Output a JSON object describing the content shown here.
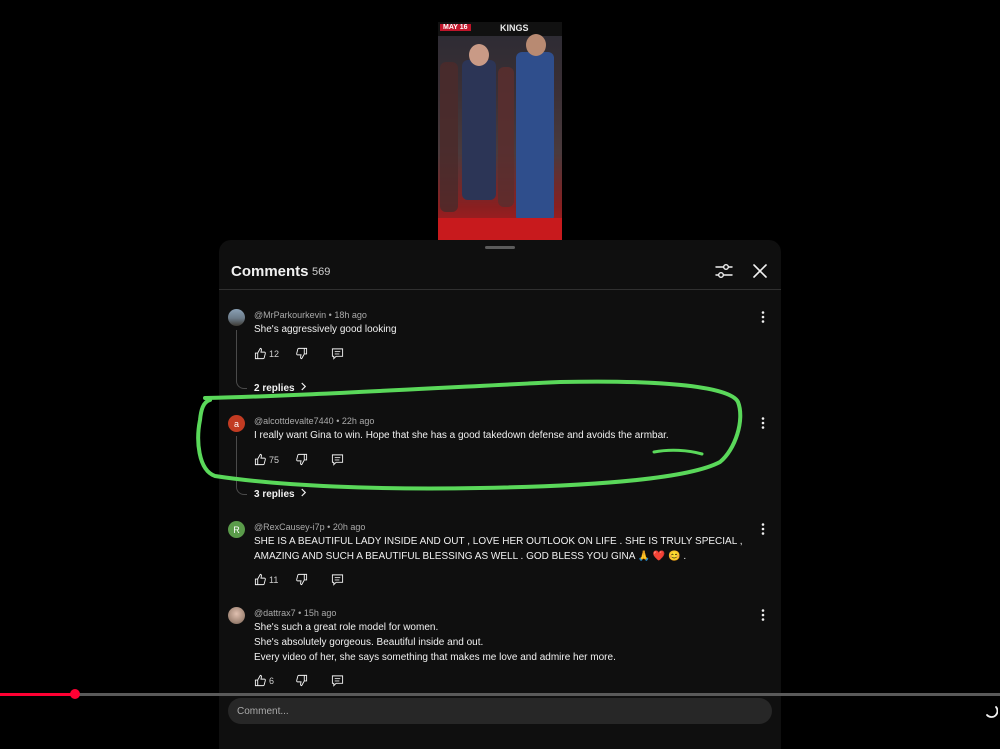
{
  "video": {
    "date_badge": "MAY 16",
    "brand_text": "KINGS"
  },
  "comments_panel": {
    "title": "Comments",
    "count": "569"
  },
  "comments": [
    {
      "avatar_letter": "",
      "avatar_color": "#6b7a88",
      "author": "@MrParkourkevin",
      "time": "18h ago",
      "text": [
        "She's aggressively good looking"
      ],
      "likes": "12",
      "replies_label": "2 replies"
    },
    {
      "avatar_letter": "a",
      "avatar_color": "#c23b22",
      "author": "@alcottdevalte7440",
      "time": "22h ago",
      "text": [
        "I really want Gina to win. Hope that she has a good takedown defense and avoids the armbar."
      ],
      "likes": "75",
      "replies_label": "3 replies"
    },
    {
      "avatar_letter": "R",
      "avatar_color": "#5a9b4a",
      "author": "@RexCausey-i7p",
      "time": "20h ago",
      "text": [
        "SHE IS A BEAUTIFUL LADY INSIDE AND OUT , LOVE HER OUTLOOK ON LIFE . SHE IS TRULY SPECIAL ,",
        "AMAZING AND SUCH A BEAUTIFUL BLESSING AS WELL . GOD BLESS YOU GINA 🙏 ❤️ 😊 ."
      ],
      "likes": "11",
      "replies_label": ""
    },
    {
      "avatar_letter": "",
      "avatar_color": "#a58a7a",
      "author": "@dattrax7",
      "time": "15h ago",
      "text": [
        "She's such a great role model for women.",
        "She's absolutely gorgeous. Beautiful inside and out.",
        "Every video of her, she says something that makes me love and admire her more."
      ],
      "likes": "6",
      "replies_label": ""
    }
  ],
  "comment_input": {
    "placeholder": "Comment..."
  },
  "player": {
    "progress_fraction": 0.075,
    "progress_color": "#ff0033"
  },
  "annotation": {
    "color": "#5ad85a"
  },
  "colors": {
    "background": "#000000",
    "panel": "#0f0f0f",
    "text": "#f1f1f1",
    "muted": "#aaaaaa"
  },
  "icons": [
    "filter-icon",
    "close-icon",
    "like-icon",
    "dislike-icon",
    "reply-icon",
    "more-options-icon",
    "chevron-right-icon",
    "loading-icon"
  ]
}
